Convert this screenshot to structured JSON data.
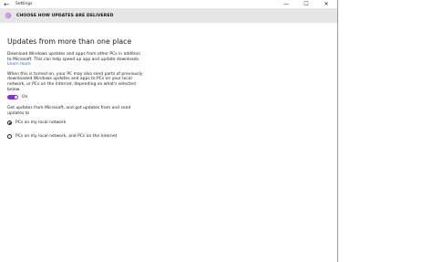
{
  "window": {
    "back_glyph": "←",
    "title": "Settings",
    "controls": [
      "—",
      "☐",
      "✕"
    ]
  },
  "header": {
    "icon": "gear-icon",
    "title": "CHOOSE HOW UPDATES ARE DELIVERED"
  },
  "main": {
    "heading": "Updates from more than one place",
    "desc_lines": [
      "Download Windows updates and apps from other PCs in addition",
      "to Microsoft. This can help speed up app and update downloads."
    ],
    "learn_more": "Learn more",
    "info_lines": [
      "When this is turned on, your PC may also send parts of previously",
      "downloaded Windows updates and apps to PCs on your local",
      "network, or PCs on the Internet, depending on what's selected",
      "below."
    ],
    "toggle": {
      "state_label": "On",
      "on": true,
      "accent": "#8a2be2"
    },
    "get_updates_lines": [
      "Get updates from Microsoft, and get updates from and send",
      "updates to"
    ],
    "options": [
      {
        "label": "PCs on my local network",
        "selected": true
      },
      {
        "label": "PCs on my local network, and PCs on the Internet",
        "selected": false
      }
    ]
  }
}
